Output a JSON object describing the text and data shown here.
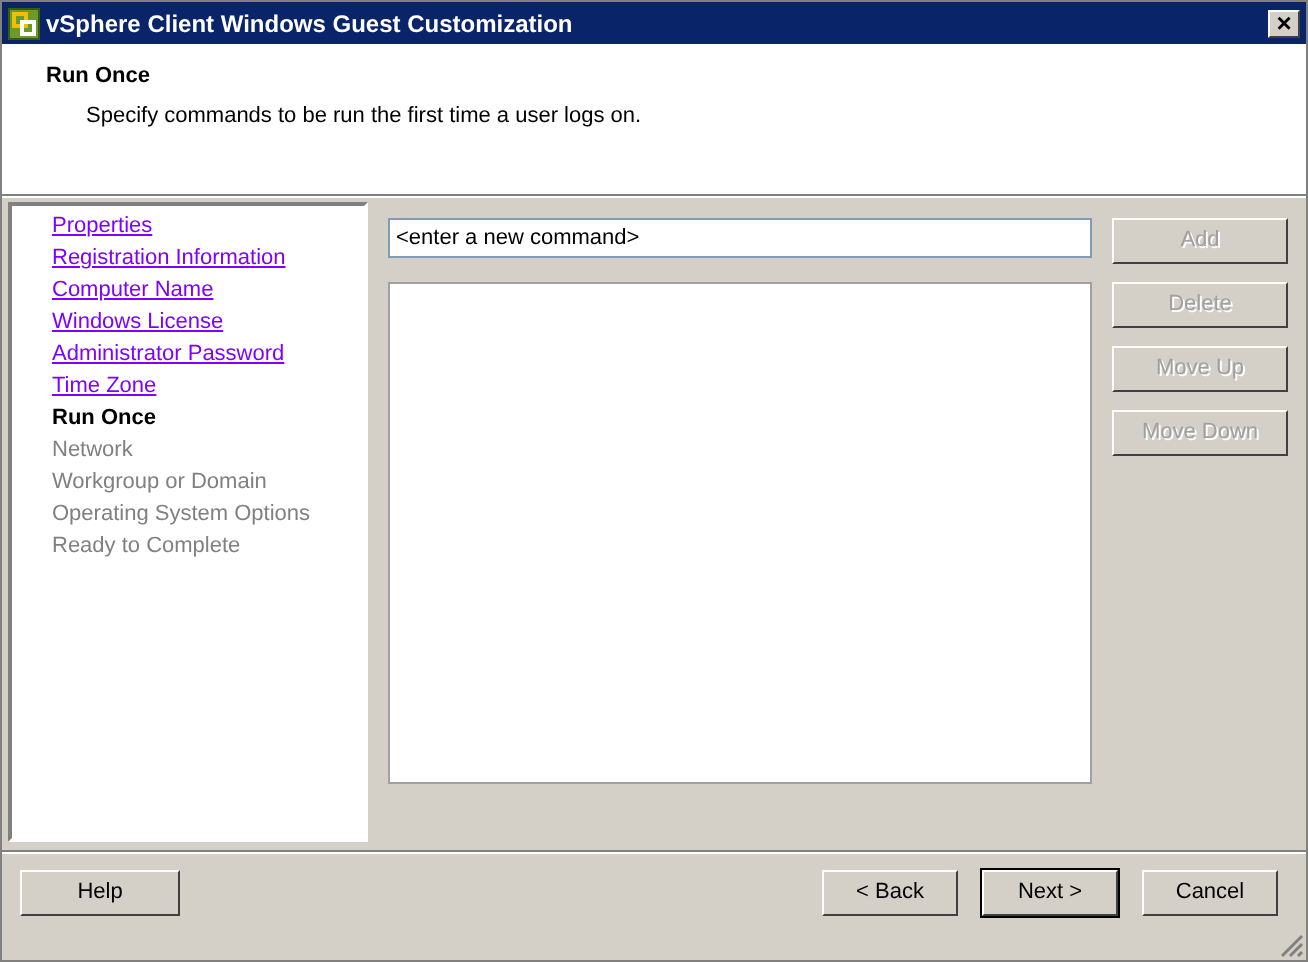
{
  "window": {
    "title": "vSphere Client Windows Guest Customization",
    "close": "×"
  },
  "header": {
    "title": "Run Once",
    "subtitle": "Specify commands to be run the first time a user logs on."
  },
  "steps": [
    {
      "label": "Properties",
      "kind": "done"
    },
    {
      "label": "Registration Information",
      "kind": "done"
    },
    {
      "label": "Computer Name",
      "kind": "done"
    },
    {
      "label": "Windows License",
      "kind": "done"
    },
    {
      "label": "Administrator Password",
      "kind": "done"
    },
    {
      "label": "Time Zone",
      "kind": "done"
    },
    {
      "label": "Run Once",
      "kind": "current"
    },
    {
      "label": "Network",
      "kind": "pending"
    },
    {
      "label": "Workgroup or Domain",
      "kind": "pending"
    },
    {
      "label": "Operating System Options",
      "kind": "pending"
    },
    {
      "label": "Ready to Complete",
      "kind": "pending"
    }
  ],
  "command_field": {
    "value": "<enter a new command>"
  },
  "side_buttons": [
    {
      "label": "Add",
      "disabled": true
    },
    {
      "label": "Delete",
      "disabled": true
    },
    {
      "label": "Move Up",
      "disabled": true
    },
    {
      "label": "Move Down",
      "disabled": true
    }
  ],
  "footer_buttons": [
    {
      "label": "Help",
      "default": false
    },
    {
      "label": "< Back",
      "default": false
    },
    {
      "label": "Next >",
      "default": true
    },
    {
      "label": "Cancel",
      "default": false
    }
  ]
}
